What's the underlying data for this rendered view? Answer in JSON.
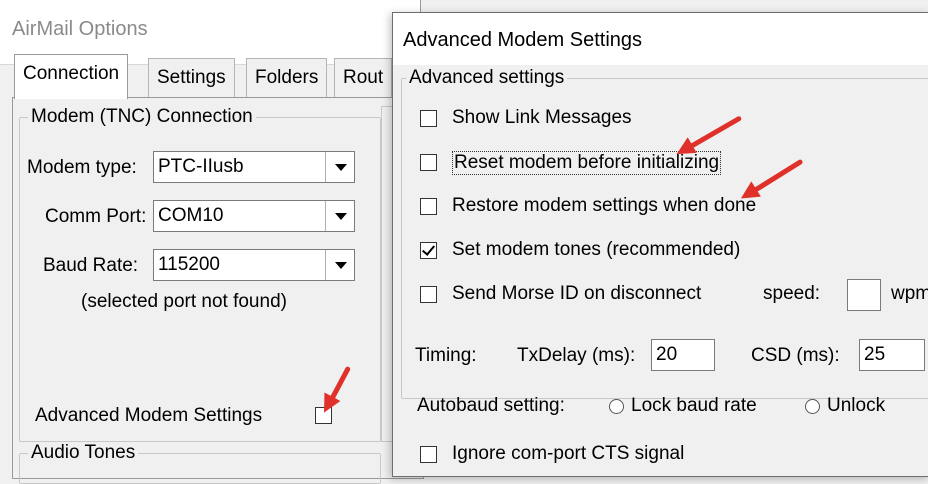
{
  "back_window": {
    "title": "AirMail Options",
    "tabs": [
      "Connection",
      "Settings",
      "Folders",
      "Rout"
    ],
    "modem_group": {
      "legend": "Modem (TNC) Connection",
      "modem_type_label": "Modem type:",
      "modem_type_value": "PTC-IIusb",
      "comm_port_label": "Comm Port:",
      "comm_port_value": "COM10",
      "baud_rate_label": "Baud Rate:",
      "baud_rate_value": "115200",
      "status_text": "(selected port not found)",
      "advanced_label": "Advanced Modem Settings",
      "advanced_checked": false
    },
    "audio_group": {
      "legend": "Audio Tones"
    }
  },
  "front_window": {
    "title": "Advanced Modem Settings",
    "group_legend": "Advanced settings",
    "checkboxes": [
      {
        "label": "Show Link Messages",
        "checked": false
      },
      {
        "label": "Reset modem before initializing",
        "checked": false
      },
      {
        "label": "Restore modem settings when done",
        "checked": false
      },
      {
        "label": "Set modem tones (recommended)",
        "checked": true
      },
      {
        "label": "Send Morse ID on disconnect",
        "checked": false
      }
    ],
    "speed_label": "speed:",
    "speed_value": "",
    "wpm_label": "wpm",
    "timing_label": "Timing:",
    "txdelay_label": "TxDelay (ms):",
    "txdelay_value": "20",
    "csd_label": "CSD (ms):",
    "csd_value": "25",
    "autobaud_label": "Autobaud setting:",
    "autobaud_options": [
      "Lock baud rate",
      "Unlock"
    ],
    "ignore_cts_label": "Ignore com-port CTS signal",
    "ignore_cts_checked": false
  },
  "colors": {
    "annotation_arrow": "#e0302a"
  }
}
